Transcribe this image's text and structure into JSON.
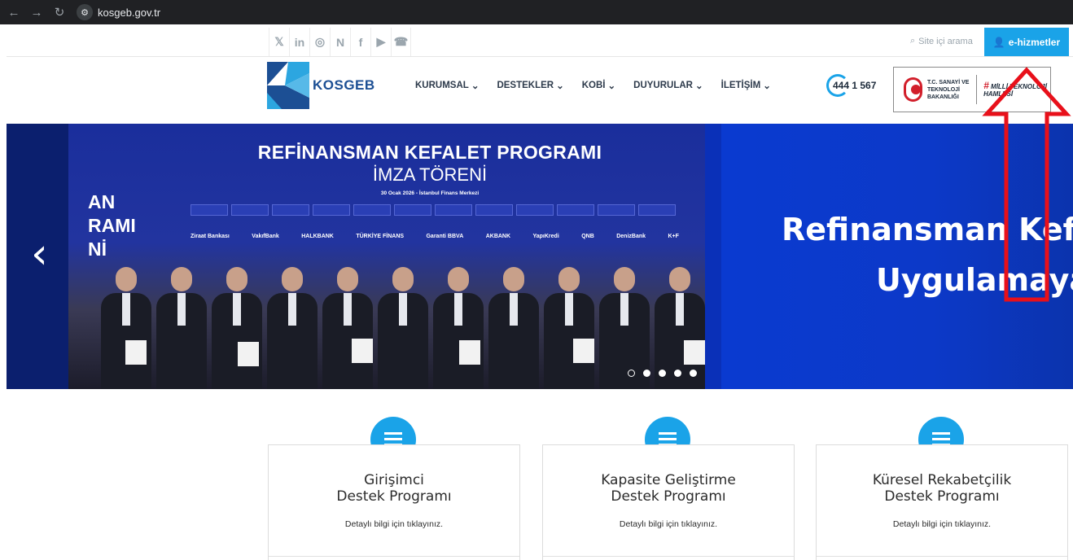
{
  "browser": {
    "url": "kosgeb.gov.tr"
  },
  "topbar": {
    "social": [
      "𝕏",
      "in",
      "◎",
      "N",
      "f",
      "▶",
      "☎"
    ],
    "search_label": "Site içi arama",
    "ehizmet_label": "e-hizmetler"
  },
  "header": {
    "logo_text": "KOSGEB",
    "menu": [
      {
        "label": "KURUMSAL"
      },
      {
        "label": "DESTEKLER"
      },
      {
        "label": "KOBİ"
      },
      {
        "label": "DUYURULAR"
      },
      {
        "label": "İLETİŞİM"
      }
    ],
    "hotline": "444 1 567",
    "ministry_text": "T.C. SANAYİ VE TEKNOLOJİ BAKANLIĞI",
    "milli_text": "MİLLİ TEKNOLOJİ HAMLESİ"
  },
  "hero": {
    "title": "REFİNANSMAN KEFALET PROGRAMI",
    "subtitle": "İMZA TÖRENİ",
    "date": "30 Ocak 2026 - İstanbul Finans Merkezi",
    "left_fragment": "AN\nRAMI\nNİ",
    "banks": [
      "Ziraat Bankası",
      "VakıfBank",
      "HALKBANK",
      "TÜRKİYE FİNANS",
      "Garanti BBVA",
      "AKBANK",
      "YapıKredi",
      "QNB",
      "DenizBank",
      "K+F"
    ],
    "slogan_line1": "Refinansman Kefa",
    "slogan_line2": "Uygulamaya",
    "dots": 5,
    "active_dot": 0
  },
  "cards": [
    {
      "title_line1": "Girişimci",
      "title_line2": "Destek Programı",
      "link": "Detaylı bilgi için tıklayınız."
    },
    {
      "title_line1": "Kapasite Geliştirme",
      "title_line2": "Destek Programı",
      "link": "Detaylı bilgi için tıklayınız."
    },
    {
      "title_line1": "Küresel Rekabetçilik",
      "title_line2": "Destek Programı",
      "link": "Detaylı bilgi için tıklayınız."
    }
  ],
  "colors": {
    "accent": "#1aa3e8",
    "brand": "#1c4f94",
    "annotation": "#e8101a"
  }
}
